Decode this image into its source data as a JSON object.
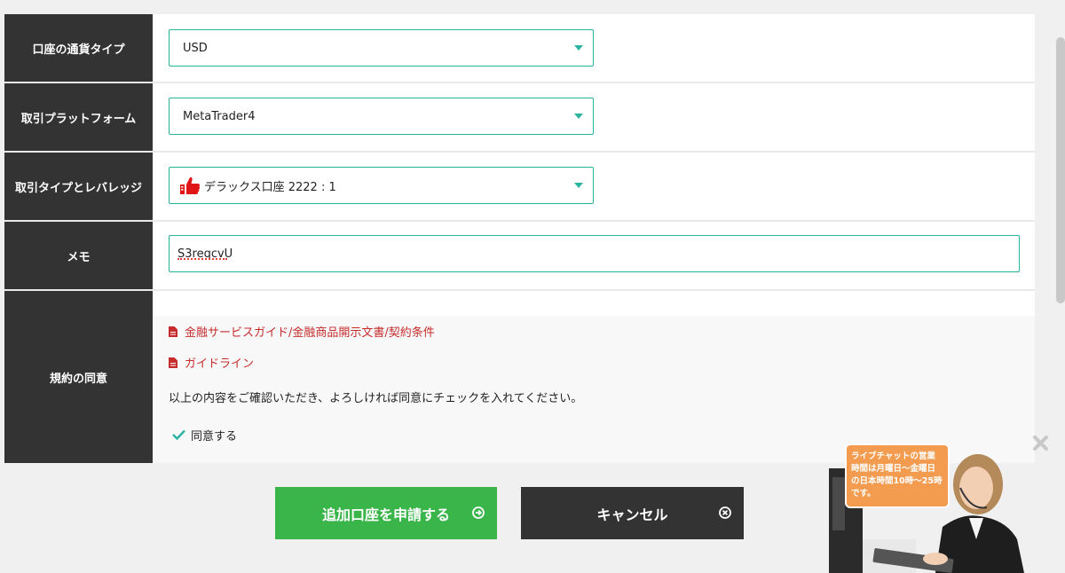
{
  "form": {
    "currency": {
      "label": "口座の通貨タイプ",
      "value": "USD"
    },
    "platform": {
      "label": "取引プラットフォーム",
      "value": "MetaTrader4"
    },
    "leverage": {
      "label": "取引タイプとレバレッジ",
      "value": "デラックス口座 2222 : 1"
    },
    "memo": {
      "label": "メモ",
      "value": "S3reqcvU"
    },
    "agreement": {
      "label": "規約の同意",
      "links": [
        "金融サービスガイド/金融商品開示文書/契約条件",
        "ガイドライン"
      ],
      "note": "以上の内容をご確認いただき、よろしければ同意にチェックを入れてください。",
      "checkbox_label": "同意する",
      "checked": true
    }
  },
  "buttons": {
    "apply": "追加口座を申請する",
    "cancel": "キャンセル"
  },
  "chat": {
    "bubble_text": "ライブチャットの営業時間は月曜日〜金曜日の日本時間10時〜25時です。"
  },
  "colors": {
    "label_bg": "#333333",
    "accent_teal": "#2ab3a0",
    "link_red": "#c62c2c",
    "apply_green": "#3ab54a",
    "chat_orange": "#f39c50"
  }
}
